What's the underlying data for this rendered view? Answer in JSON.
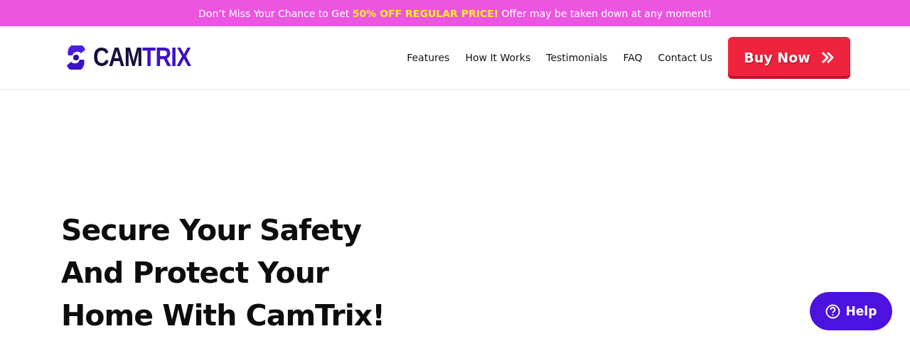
{
  "promo_banner": {
    "text": "Don’t Miss Your Chance to Get **50% OFF REGULAR PRICE!** Offer may be taken down at any moment!"
  },
  "header": {
    "logo_dark": "CAM",
    "logo_accent": "TRIX",
    "nav": [
      {
        "label": "Features"
      },
      {
        "label": "How It Works"
      },
      {
        "label": "Testimonials"
      },
      {
        "label": "FAQ"
      },
      {
        "label": "Contact Us"
      }
    ],
    "cta": {
      "label": "Buy Now"
    }
  },
  "hero": {
    "heading_lines": [
      "Secure Your Safety",
      "And Protect Your",
      "Home With CamTrix!"
    ]
  },
  "help_button": {
    "label": "Help"
  }
}
